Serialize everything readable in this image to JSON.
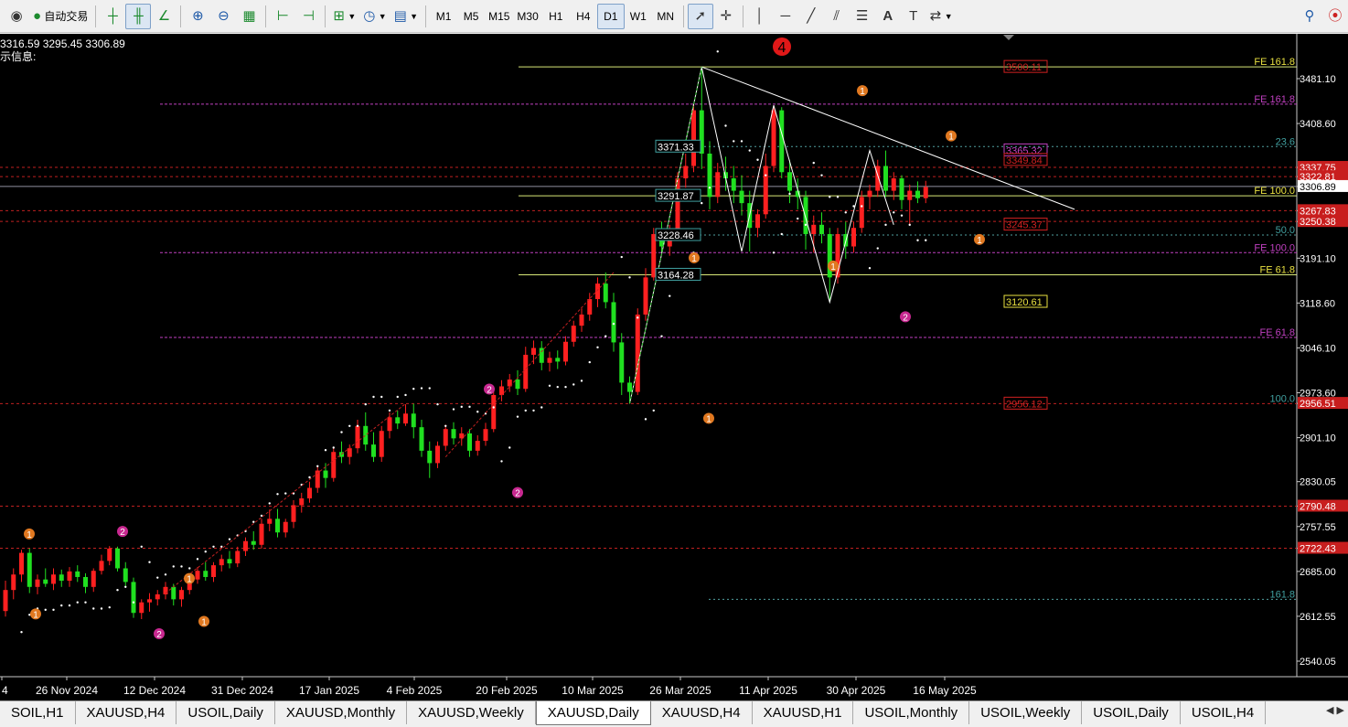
{
  "toolbar": {
    "auto_trade_label": "自动交易",
    "timeframes": [
      "M1",
      "M5",
      "M15",
      "M30",
      "H1",
      "H4",
      "D1",
      "W1",
      "MN"
    ],
    "active_timeframe": "D1"
  },
  "chart": {
    "ohlc_text": "3316.59 3295.45 3306.89",
    "info_text": "示信息:",
    "colors": {
      "bull": "#ff2020",
      "bear": "#20e020",
      "background": "#000000"
    }
  },
  "chart_data": {
    "type": "candlestick",
    "price_labels": [
      "3481.10",
      "3408.60",
      "3337.75",
      "3322.81",
      "3306.89",
      "3267.83",
      "3250.38",
      "3191.10",
      "3118.60",
      "3046.10",
      "2973.60",
      "2956.51",
      "2901.10",
      "2830.05",
      "2790.48",
      "2757.55",
      "2722.43",
      "2685.00",
      "2612.55",
      "2540.05"
    ],
    "date_labels": [
      "4",
      "26 Nov 2024",
      "12 Dec 2024",
      "31 Dec 2024",
      "17 Jan 2025",
      "4 Feb 2025",
      "20 Feb 2025",
      "10 Mar 2025",
      "26 Mar 2025",
      "11 Apr 2025",
      "30 Apr 2025",
      "16 May 2025"
    ],
    "boxed_levels": [
      "3500.11",
      "3365.32",
      "3349.84",
      "3245.37",
      "3120.61",
      "2956.12"
    ],
    "fib_boxes": [
      "3371.33",
      "3291.87",
      "3228.46",
      "3164.28"
    ],
    "fib_labels": [
      "FE 161.8",
      "FE 161.8",
      "23.6",
      "FE 100.0",
      "50.0",
      "FE 100.0",
      "FE 61.8",
      "FE 61.8",
      "100.0",
      "161.8"
    ],
    "wave_labels": {
      "big": "4",
      "w1": "1",
      "w2": "2"
    },
    "candles": [
      [
        2621,
        2670,
        2612,
        2655
      ],
      [
        2655,
        2690,
        2640,
        2680
      ],
      [
        2680,
        2720,
        2668,
        2715
      ],
      [
        2715,
        2722,
        2650,
        2660
      ],
      [
        2660,
        2680,
        2648,
        2672
      ],
      [
        2672,
        2690,
        2660,
        2665
      ],
      [
        2665,
        2690,
        2655,
        2680
      ],
      [
        2680,
        2688,
        2660,
        2670
      ],
      [
        2670,
        2692,
        2660,
        2685
      ],
      [
        2685,
        2695,
        2668,
        2676
      ],
      [
        2676,
        2682,
        2650,
        2660
      ],
      [
        2660,
        2690,
        2652,
        2686
      ],
      [
        2686,
        2712,
        2680,
        2702
      ],
      [
        2702,
        2726,
        2695,
        2722
      ],
      [
        2722,
        2725,
        2685,
        2690
      ],
      [
        2690,
        2700,
        2660,
        2668
      ],
      [
        2668,
        2675,
        2610,
        2618
      ],
      [
        2618,
        2640,
        2608,
        2635
      ],
      [
        2635,
        2650,
        2620,
        2640
      ],
      [
        2640,
        2655,
        2630,
        2648
      ],
      [
        2648,
        2668,
        2640,
        2660
      ],
      [
        2660,
        2665,
        2630,
        2640
      ],
      [
        2640,
        2660,
        2628,
        2655
      ],
      [
        2655,
        2680,
        2648,
        2672
      ],
      [
        2672,
        2692,
        2665,
        2686
      ],
      [
        2686,
        2700,
        2670,
        2676
      ],
      [
        2676,
        2700,
        2668,
        2695
      ],
      [
        2695,
        2712,
        2685,
        2705
      ],
      [
        2705,
        2718,
        2690,
        2698
      ],
      [
        2698,
        2725,
        2692,
        2718
      ],
      [
        2718,
        2740,
        2710,
        2734
      ],
      [
        2734,
        2750,
        2720,
        2728
      ],
      [
        2728,
        2770,
        2722,
        2762
      ],
      [
        2762,
        2785,
        2750,
        2770
      ],
      [
        2770,
        2786,
        2740,
        2748
      ],
      [
        2748,
        2770,
        2740,
        2765
      ],
      [
        2765,
        2800,
        2755,
        2792
      ],
      [
        2792,
        2812,
        2780,
        2803
      ],
      [
        2803,
        2830,
        2796,
        2820
      ],
      [
        2820,
        2856,
        2812,
        2848
      ],
      [
        2848,
        2860,
        2820,
        2836
      ],
      [
        2836,
        2885,
        2830,
        2878
      ],
      [
        2878,
        2895,
        2860,
        2870
      ],
      [
        2870,
        2890,
        2858,
        2884
      ],
      [
        2884,
        2930,
        2876,
        2920
      ],
      [
        2920,
        2942,
        2880,
        2890
      ],
      [
        2890,
        2910,
        2862,
        2870
      ],
      [
        2870,
        2920,
        2862,
        2912
      ],
      [
        2912,
        2942,
        2900,
        2934
      ],
      [
        2934,
        2945,
        2915,
        2924
      ],
      [
        2924,
        2955,
        2920,
        2940
      ],
      [
        2940,
        2956,
        2900,
        2918
      ],
      [
        2918,
        2930,
        2870,
        2880
      ],
      [
        2880,
        2895,
        2836,
        2860
      ],
      [
        2860,
        2895,
        2852,
        2888
      ],
      [
        2888,
        2922,
        2880,
        2915
      ],
      [
        2915,
        2926,
        2890,
        2900
      ],
      [
        2900,
        2918,
        2888,
        2908
      ],
      [
        2908,
        2915,
        2870,
        2880
      ],
      [
        2880,
        2905,
        2872,
        2896
      ],
      [
        2896,
        2925,
        2888,
        2915
      ],
      [
        2915,
        2978,
        2910,
        2970
      ],
      [
        2970,
        2994,
        2960,
        2984
      ],
      [
        2984,
        3004,
        2975,
        2995
      ],
      [
        2995,
        3010,
        2970,
        2980
      ],
      [
        2980,
        3048,
        2975,
        3035
      ],
      [
        3035,
        3058,
        3020,
        3046
      ],
      [
        3046,
        3057,
        3010,
        3022
      ],
      [
        3022,
        3040,
        3008,
        3030
      ],
      [
        3030,
        3042,
        3012,
        3024
      ],
      [
        3024,
        3065,
        3018,
        3056
      ],
      [
        3056,
        3090,
        3048,
        3082
      ],
      [
        3082,
        3110,
        3072,
        3100
      ],
      [
        3100,
        3135,
        3090,
        3125
      ],
      [
        3125,
        3160,
        3112,
        3150
      ],
      [
        3150,
        3168,
        3110,
        3120
      ],
      [
        3120,
        3135,
        3040,
        3055
      ],
      [
        3055,
        3070,
        2970,
        2990
      ],
      [
        2990,
        3000,
        2956,
        2975
      ],
      [
        2975,
        3110,
        2970,
        3100
      ],
      [
        3100,
        3175,
        3090,
        3160
      ],
      [
        3160,
        3240,
        3155,
        3230
      ],
      [
        3230,
        3250,
        3200,
        3210
      ],
      [
        3210,
        3245,
        3195,
        3230
      ],
      [
        3230,
        3330,
        3225,
        3320
      ],
      [
        3320,
        3360,
        3305,
        3340
      ],
      [
        3340,
        3440,
        3330,
        3430
      ],
      [
        3430,
        3500,
        3335,
        3360
      ],
      [
        3360,
        3380,
        3270,
        3290
      ],
      [
        3290,
        3345,
        3280,
        3330
      ],
      [
        3330,
        3355,
        3300,
        3320
      ],
      [
        3320,
        3340,
        3280,
        3300
      ],
      [
        3300,
        3325,
        3260,
        3280
      ],
      [
        3280,
        3300,
        3202,
        3240
      ],
      [
        3240,
        3270,
        3225,
        3262
      ],
      [
        3262,
        3360,
        3255,
        3340
      ],
      [
        3340,
        3438,
        3330,
        3430
      ],
      [
        3430,
        3435,
        3320,
        3330
      ],
      [
        3330,
        3350,
        3280,
        3300
      ],
      [
        3300,
        3320,
        3270,
        3290
      ],
      [
        3290,
        3300,
        3205,
        3230
      ],
      [
        3230,
        3260,
        3200,
        3245
      ],
      [
        3245,
        3265,
        3215,
        3230
      ],
      [
        3230,
        3240,
        3120,
        3160
      ],
      [
        3160,
        3240,
        3150,
        3230
      ],
      [
        3230,
        3250,
        3190,
        3210
      ],
      [
        3210,
        3250,
        3200,
        3240
      ],
      [
        3240,
        3300,
        3232,
        3290
      ],
      [
        3290,
        3310,
        3270,
        3300
      ],
      [
        3300,
        3350,
        3290,
        3340
      ],
      [
        3340,
        3365,
        3290,
        3300
      ],
      [
        3300,
        3330,
        3285,
        3320
      ],
      [
        3320,
        3325,
        3270,
        3285
      ],
      [
        3285,
        3310,
        3245,
        3300
      ],
      [
        3300,
        3315,
        3280,
        3288
      ],
      [
        3288,
        3316,
        3280,
        3306
      ]
    ]
  },
  "tabs": [
    "SOIL,H1",
    "XAUUSD,H4",
    "USOIL,Daily",
    "XAUUSD,Monthly",
    "XAUUSD,Weekly",
    "XAUUSD,Daily",
    "XAUUSD,H4",
    "XAUUSD,H1",
    "USOIL,Monthly",
    "USOIL,Weekly",
    "USOIL,Daily",
    "USOIL,H4"
  ],
  "active_tab": "XAUUSD,Daily"
}
